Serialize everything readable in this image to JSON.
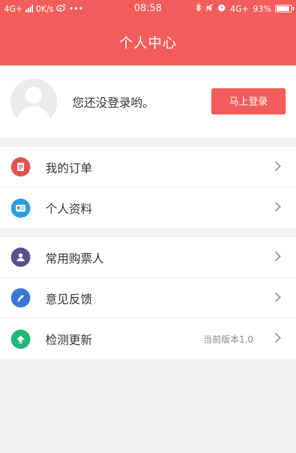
{
  "status_bar": {
    "network": "4G+",
    "speed": "0K/s",
    "dots": "•••",
    "time": "08:58",
    "network_right": "4G+",
    "battery": "93%",
    "battery_level": 0.93
  },
  "header": {
    "title": "个人中心"
  },
  "profile": {
    "message": "您还没登录哟。",
    "login_button": "马上登录"
  },
  "menu_group1": [
    {
      "label": "我的订单",
      "icon": "order-list-icon",
      "color": "#e0524f"
    },
    {
      "label": "个人资料",
      "icon": "id-card-icon",
      "color": "#2e9ee0"
    }
  ],
  "menu_group2": [
    {
      "label": "常用购票人",
      "icon": "person-icon",
      "color": "#5a4e8f"
    },
    {
      "label": "意见反馈",
      "icon": "pencil-icon",
      "color": "#3a78d8"
    },
    {
      "label": "检测更新",
      "icon": "upload-arrow-icon",
      "color": "#1fb87a",
      "extra": "当前版本1.0"
    }
  ],
  "colors": {
    "accent": "#f25d5b",
    "background": "#f2f2f2"
  }
}
